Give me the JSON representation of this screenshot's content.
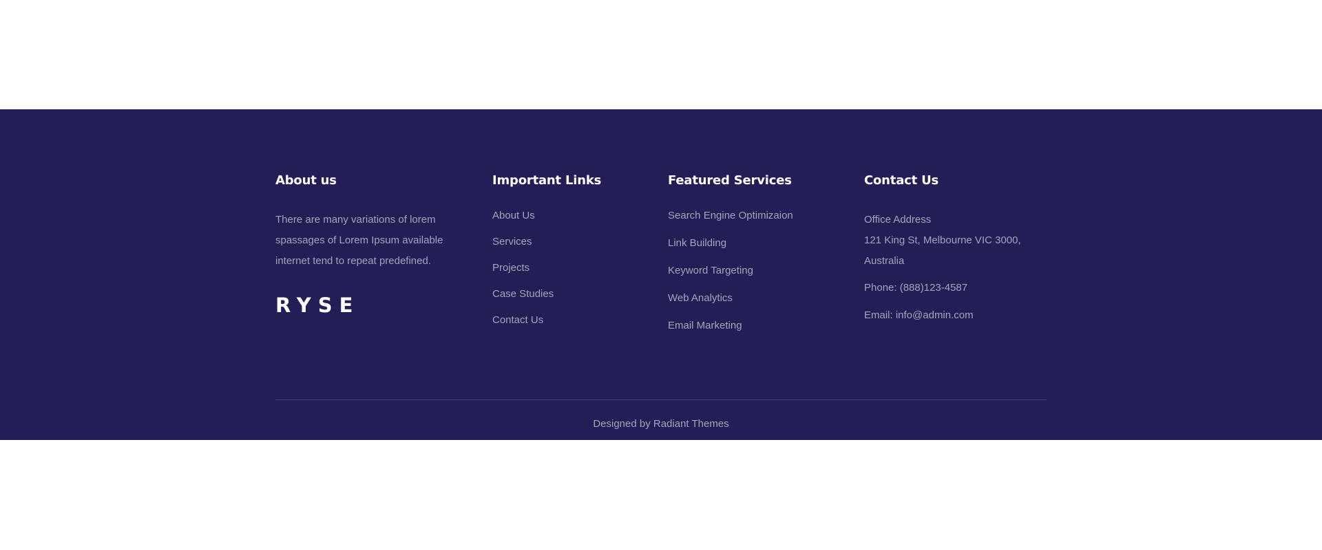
{
  "footer": {
    "about": {
      "title": "About us",
      "text": "There are many variations of lorem spassages of Lorem Ipsum available internet tend to repeat predefined.",
      "logo": "RYSE"
    },
    "important_links": {
      "title": "Important Links",
      "items": [
        "About Us",
        "Services",
        "Projects",
        "Case Studies",
        "Contact Us"
      ]
    },
    "featured_services": {
      "title": "Featured Services",
      "items": [
        "Search Engine Optimizaion",
        "Link Building",
        "Keyword Targeting",
        "Web Analytics",
        "Email Marketing"
      ]
    },
    "contact": {
      "title": "Contact Us",
      "office_label": "Office Address",
      "address": "121 King St, Melbourne VIC 3000, Australia",
      "phone": "Phone: (888)123-4587",
      "email": "Email: info@admin.com"
    },
    "credits": "Designed by Radiant Themes"
  },
  "colors": {
    "footer_background": "#241e56",
    "heading": "#ffffff",
    "body_text": "#a5a2bd",
    "divider": "#48437a"
  }
}
